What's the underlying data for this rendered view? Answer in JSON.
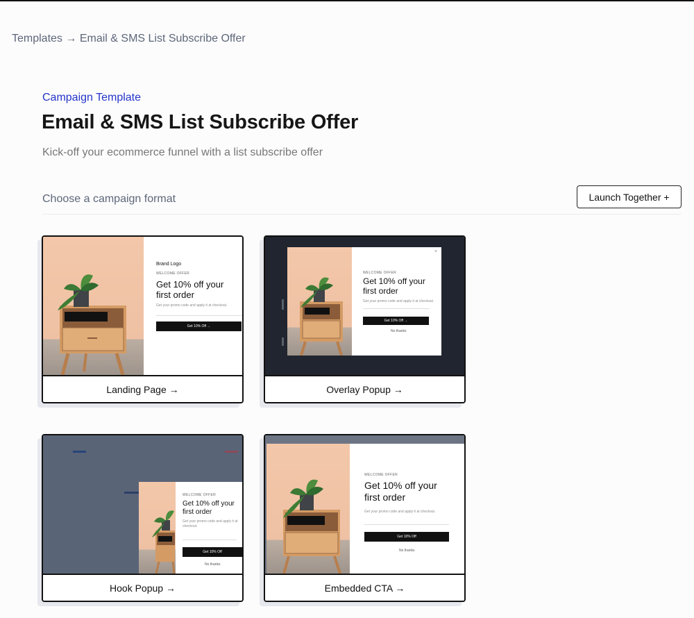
{
  "breadcrumb": {
    "root": "Templates",
    "separator": "→",
    "current": "Email & SMS List Subscribe Offer"
  },
  "header": {
    "eyebrow": "Campaign Template",
    "title": "Email & SMS List Subscribe Offer",
    "subtitle": "Kick-off your ecommerce funnel with a list subscribe offer"
  },
  "formats": {
    "heading": "Choose a campaign format",
    "launch_button": "Launch Together +"
  },
  "cards": [
    {
      "label": "Landing Page →",
      "brand": "Brand Logo",
      "eyebrow": "WELCOME OFFER",
      "headline": "Get 10% off your first order",
      "copy": "Get your promo code and apply it at checkout.",
      "cta": "Get 10% Off →"
    },
    {
      "label": "Overlay Popup →",
      "eyebrow": "WELCOME OFFER",
      "headline": "Get 10% off your first order",
      "copy": "Get your promo code and apply it at checkout.",
      "cta": "Get 10% Off →",
      "dismiss": "No thanks"
    },
    {
      "label": "Hook Popup →",
      "eyebrow": "WELCOME OFFER",
      "headline": "Get 10% off your first order",
      "copy": "Get your promo code and apply it at checkout.",
      "cta": "Get 10% Off",
      "dismiss": "No thanks"
    },
    {
      "label": "Embedded CTA →",
      "eyebrow": "WELCOME OFFER",
      "headline": "Get 10% off your first order",
      "copy": "Get your promo code and apply it at checkout.",
      "cta": "Get 10% Off",
      "dismiss": "No thanks"
    }
  ],
  "colors": {
    "accent": "#2434c8",
    "muted_text": "#5d6678",
    "overlay_background": "#20252f",
    "hook_background": "#5a6477",
    "preview_warm_wall": "#f3c7a9",
    "furniture_wood": "#d49b64"
  },
  "icons": {
    "plant": "potted-plant-illustration",
    "close": "close-icon",
    "arrow": "right-arrow"
  }
}
